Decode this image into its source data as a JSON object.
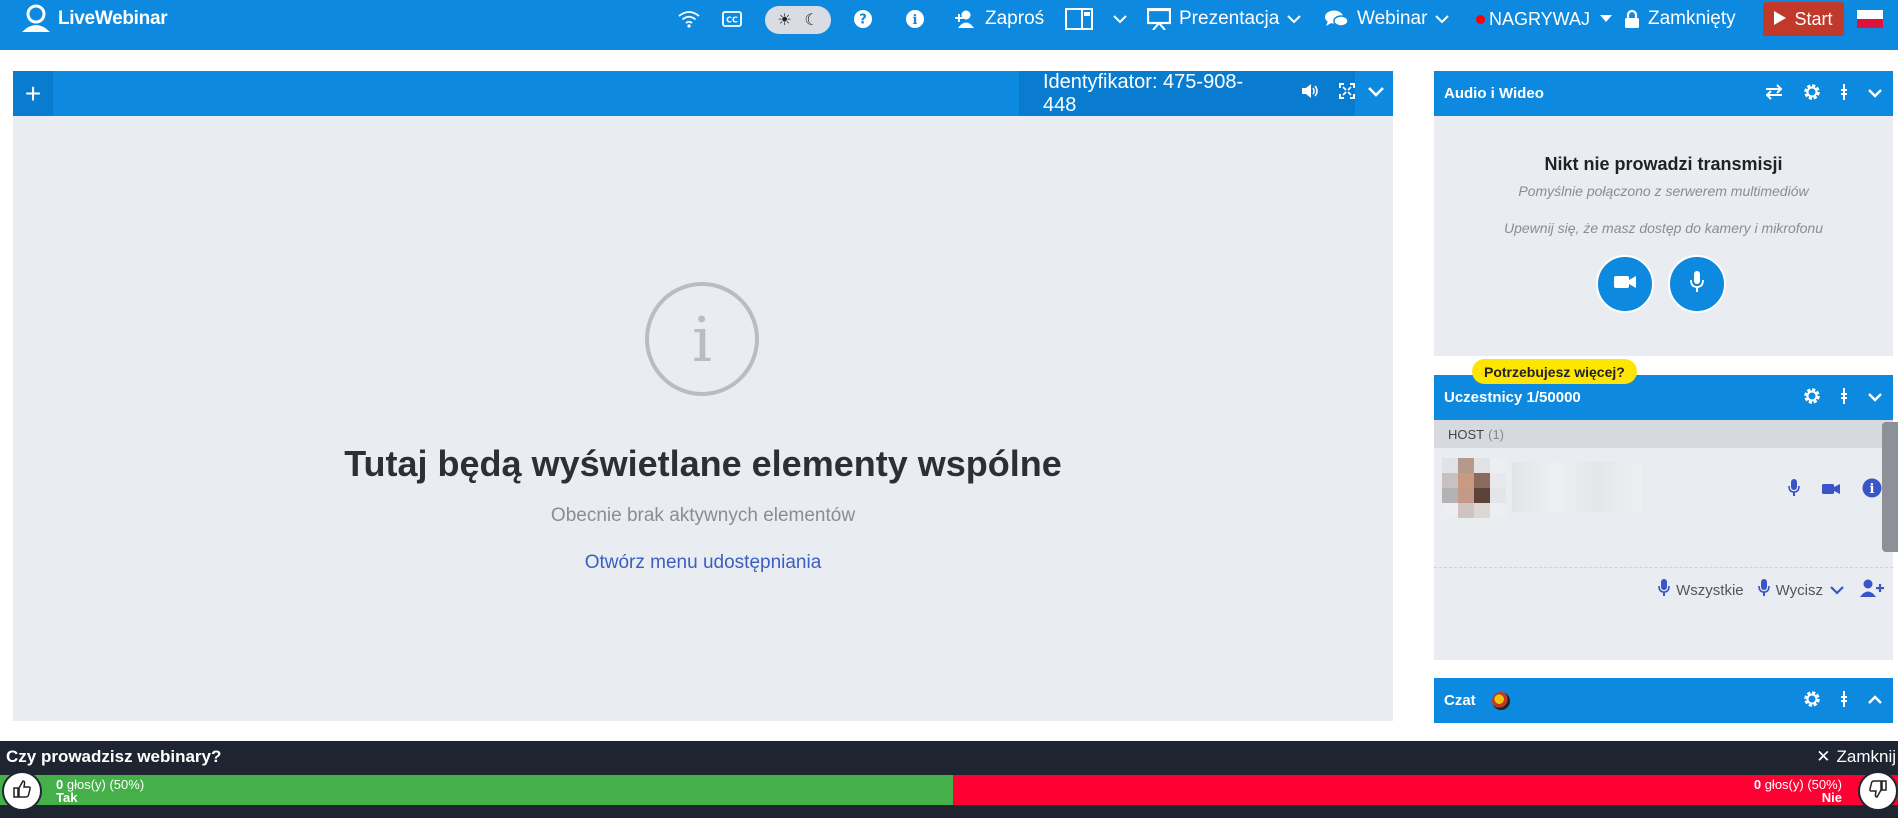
{
  "app": {
    "logo_text": "LiveWebinar"
  },
  "topbar": {
    "invite_label": "Zaproś",
    "presentation_label": "Prezentacja",
    "webinar_label": "Webinar",
    "record_label": "NAGRYWAJ",
    "locked_label": "Zamknięty",
    "start_label": "Start"
  },
  "main": {
    "identifier": "Identyfikator: 475-908-448",
    "info_glyph": "i",
    "title": "Tutaj będą wyświetlane elementy wspólne",
    "subtitle": "Obecnie brak aktywnych elementów",
    "link": "Otwórz menu udostępniania"
  },
  "av_panel": {
    "title": "Audio i Wideo",
    "message": "Nikt nie prowadzi transmisji",
    "connected": "Pomyślnie połączono z serwerem multimediów",
    "hint": "Upewnij się, że masz dostęp do kamery i mikrofonu"
  },
  "participants": {
    "badge": "Potrzebujesz więcej?",
    "title": "Uczestnicy 1/50000",
    "host_label": "HOST",
    "host_count": "(1)",
    "mute_all_label": "Wszystkie",
    "silence_label": "Wycisz"
  },
  "chat": {
    "title": "Czat"
  },
  "poll": {
    "question": "Czy prowadzisz webinary?",
    "close_label": "Zamknij",
    "yes": {
      "votes": "0",
      "votes_suffix": "głos(y) (50%)",
      "label": "Tak",
      "share": 0.5
    },
    "no": {
      "votes": "0",
      "votes_suffix": "głos(y) (50%)",
      "label": "Nie",
      "share": 0.5
    }
  },
  "colors": {
    "brand_blue": "#0d8ae0",
    "start_red": "#c0392b",
    "yes_green": "#45b04a",
    "no_red": "#ff0033",
    "badge_yellow": "#ffe600"
  },
  "icons": [
    "wifi-icon",
    "cc-icon",
    "sun-icon",
    "moon-icon",
    "help-icon",
    "info-icon",
    "add-user-icon",
    "layout-icon",
    "presentation-icon",
    "chat-bubbles-icon",
    "lock-icon",
    "play-icon",
    "poland-flag-icon",
    "plus-icon",
    "volume-icon",
    "fullscreen-icon",
    "chevron-down-icon",
    "swap-icon",
    "gear-icon",
    "dots-vertical-icon",
    "camera-icon",
    "microphone-icon",
    "thumbs-up-icon",
    "thumbs-down-icon",
    "close-icon"
  ]
}
